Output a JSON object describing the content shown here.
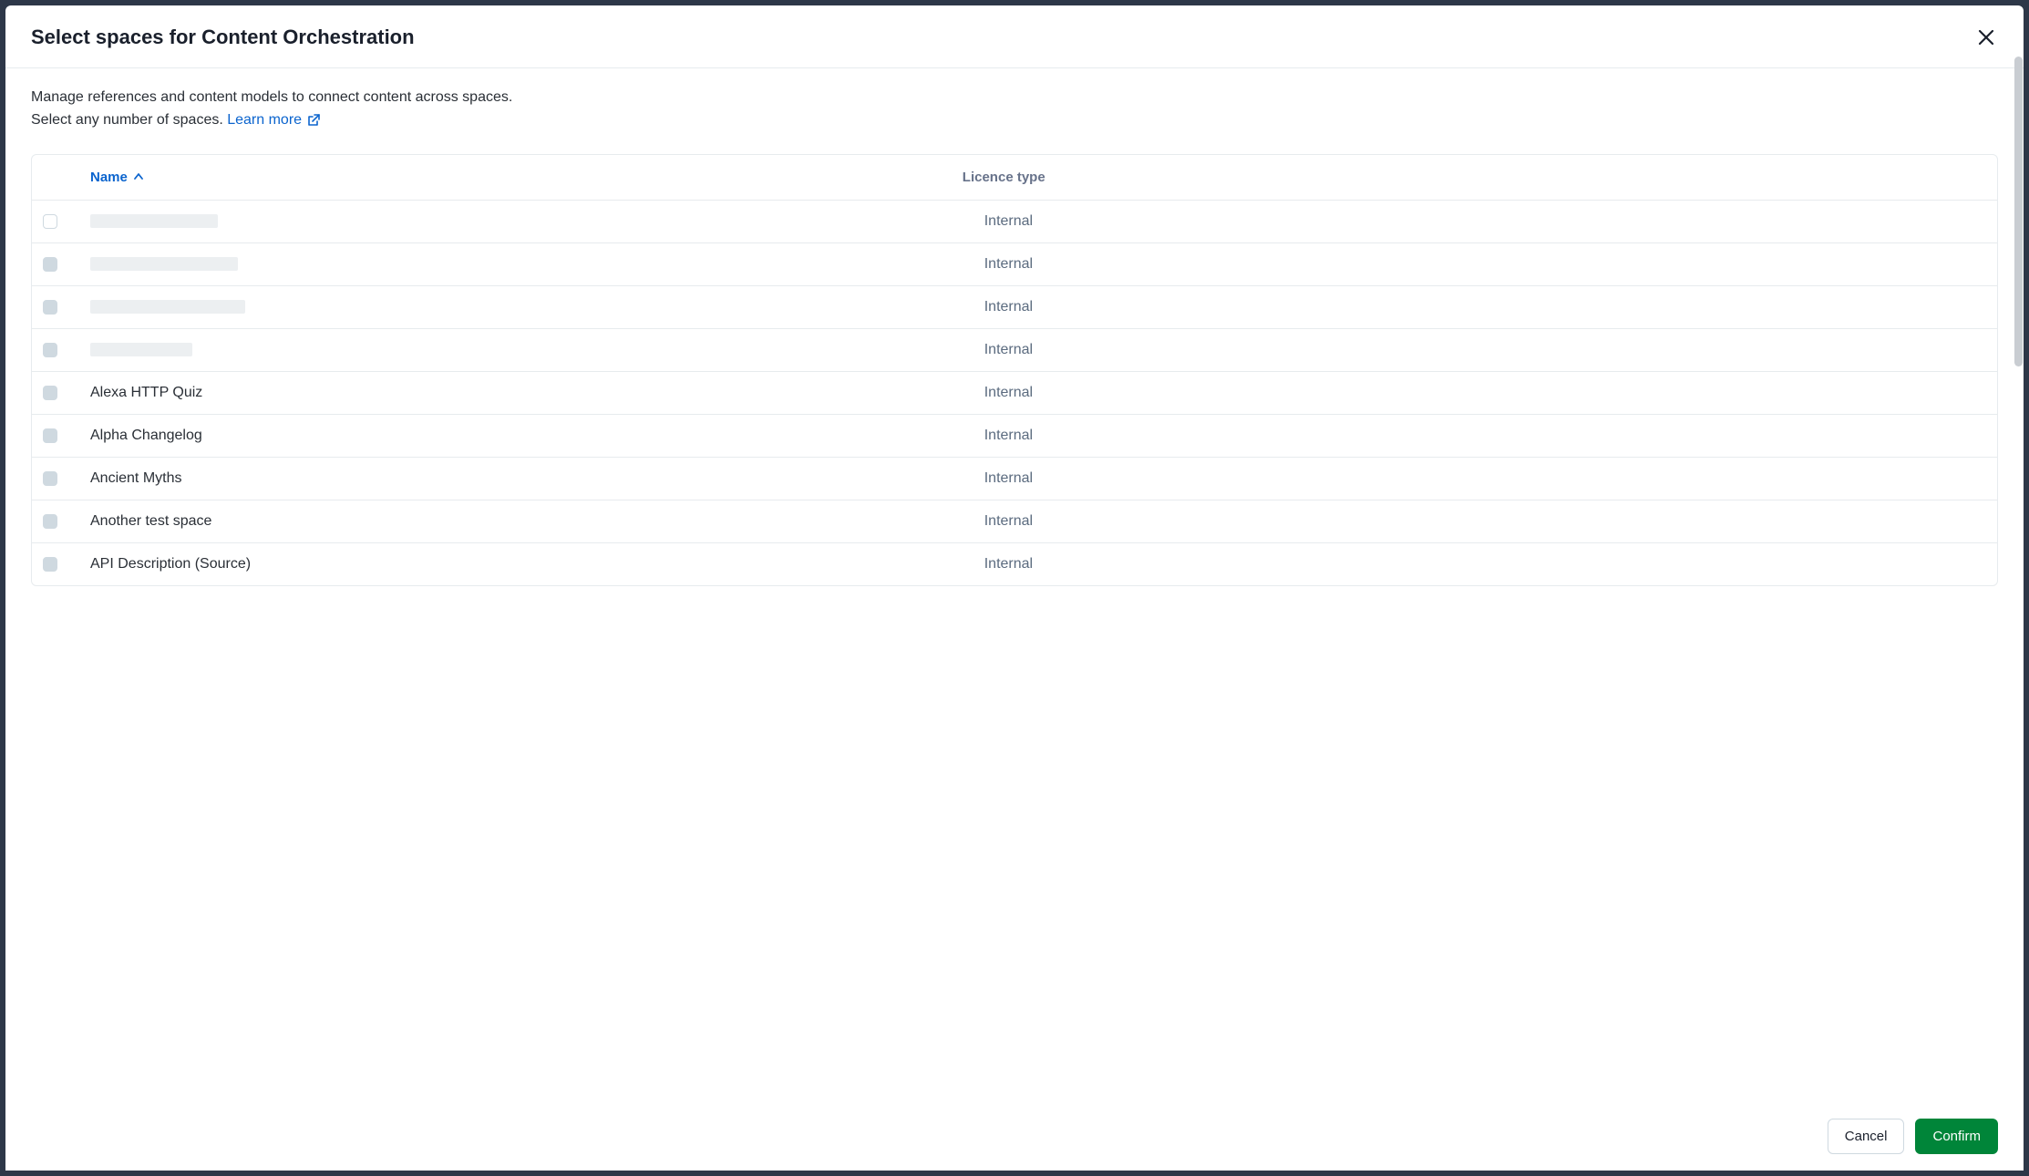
{
  "modal": {
    "title": "Select spaces for Content Orchestration",
    "description_line1": "Manage references and content models to connect content across spaces.",
    "description_line2": "Select any number of spaces.",
    "learn_more": "Learn more"
  },
  "table": {
    "columns": {
      "name": "Name",
      "licence": "Licence type"
    },
    "rows": [
      {
        "redacted": true,
        "redact_width": 140,
        "checkbox_filled": false,
        "licence": "Internal"
      },
      {
        "redacted": true,
        "redact_width": 162,
        "checkbox_filled": true,
        "licence": "Internal"
      },
      {
        "redacted": true,
        "redact_width": 170,
        "checkbox_filled": true,
        "licence": "Internal"
      },
      {
        "redacted": true,
        "redact_width": 112,
        "checkbox_filled": true,
        "licence": "Internal"
      },
      {
        "redacted": false,
        "name": "Alexa HTTP Quiz",
        "checkbox_filled": true,
        "licence": "Internal"
      },
      {
        "redacted": false,
        "name": "Alpha Changelog",
        "checkbox_filled": true,
        "licence": "Internal"
      },
      {
        "redacted": false,
        "name": "Ancient Myths",
        "checkbox_filled": true,
        "licence": "Internal"
      },
      {
        "redacted": false,
        "name": "Another test space",
        "checkbox_filled": true,
        "licence": "Internal"
      },
      {
        "redacted": false,
        "name": "API Description (Source)",
        "checkbox_filled": true,
        "licence": "Internal"
      }
    ]
  },
  "buttons": {
    "cancel": "Cancel",
    "confirm": "Confirm"
  }
}
